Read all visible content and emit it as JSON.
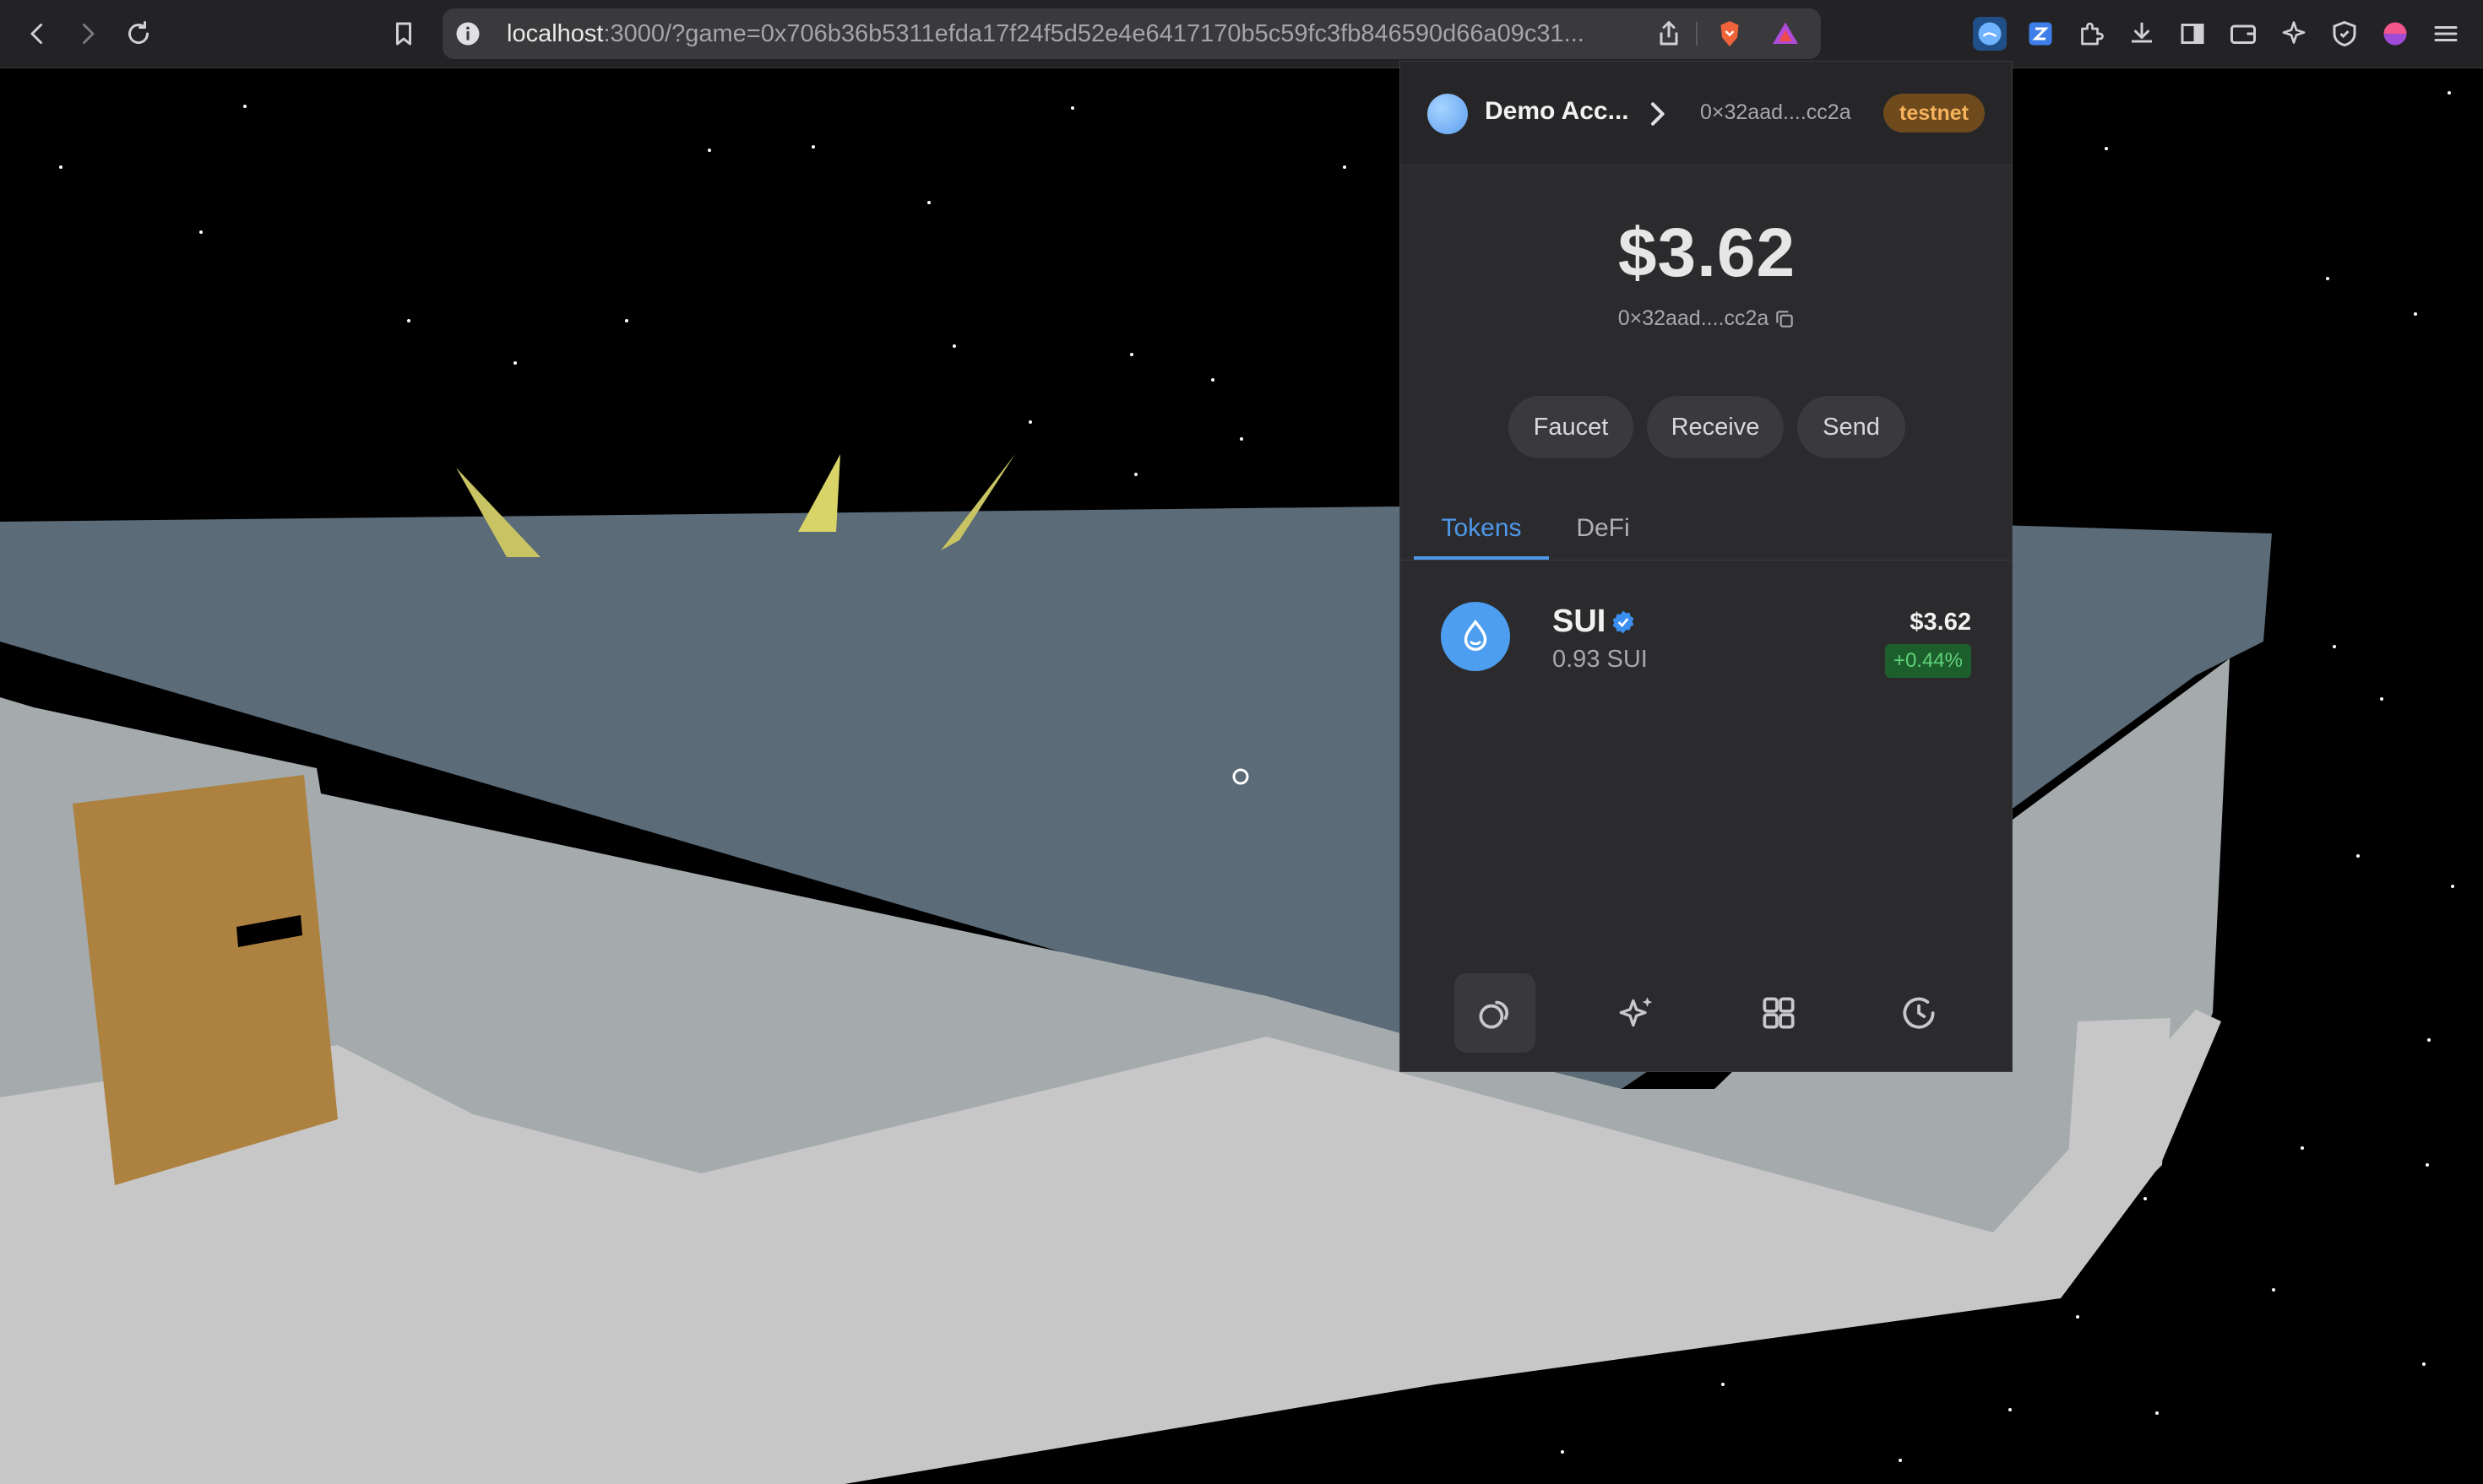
{
  "browser": {
    "url_host": "localhost",
    "url_rest": ":3000/?game=0x706b36b5311efda17f24f5d52e4e6417170b5c59fc3fb846590d66a09c31..."
  },
  "wallet": {
    "account_name": "Demo Acc...",
    "account_address": "0×32aad....cc2a",
    "network": "testnet",
    "balance": "$3.62",
    "address_short": "0×32aad....cc2a",
    "actions": [
      "Faucet",
      "Receive",
      "Send"
    ],
    "tabs": [
      "Tokens",
      "DeFi"
    ],
    "active_tab": "Tokens",
    "tokens": [
      {
        "symbol": "SUI",
        "amount": "0.93 SUI",
        "usd": "$3.62",
        "change": "+0.44%",
        "verified": true
      }
    ],
    "bottom_nav": [
      "home-icon",
      "sparkle-icon",
      "apps-grid-icon",
      "history-icon"
    ]
  },
  "colors": {
    "accent": "#4e98ea",
    "badge_bg": "#6e4a1d",
    "badge_text": "#f6b25c",
    "positive": "#5fd179"
  }
}
